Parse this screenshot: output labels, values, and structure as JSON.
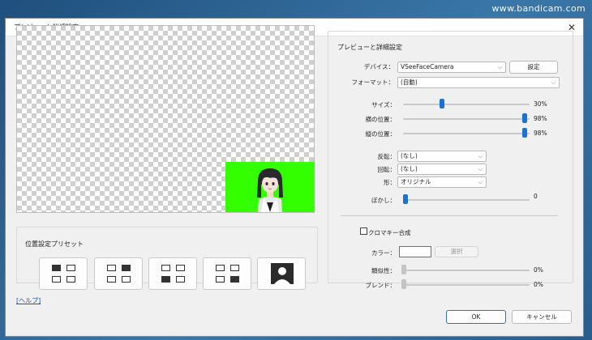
{
  "watermark": "www.bandicam.com",
  "window": {
    "title": "プレビューと詳細設定",
    "close_label": "✕"
  },
  "preset": {
    "group_label": "位置設定プリセット",
    "buttons": [
      {
        "name": "top-left",
        "active_cell": "top-left"
      },
      {
        "name": "top-right",
        "active_cell": "top-right"
      },
      {
        "name": "bottom-left",
        "active_cell": "bottom-left"
      },
      {
        "name": "bottom-right",
        "active_cell": "bottom-right"
      },
      {
        "name": "fullscreen",
        "active_cell": "full"
      }
    ]
  },
  "settings": {
    "group_label": "プレビューと詳細設定",
    "device_label": "デバイス：",
    "device_value": "VSeeFaceCamera",
    "device_settings_button": "設定",
    "format_label": "フォーマット：",
    "format_value": "(自動)",
    "size_label": "サイズ：",
    "size_value": "30%",
    "size_level": 0.3,
    "hpos_label": "横の位置：",
    "hpos_value": "98%",
    "hpos_level": 0.98,
    "vpos_label": "縦の位置：",
    "vpos_value": "98%",
    "vpos_level": 0.98,
    "flip_label": "反転：",
    "flip_value": "(なし)",
    "rotate_label": "回転：",
    "rotate_value": "(なし)",
    "shape_label": "形：",
    "shape_value": "オリジナル",
    "blur_label": "ぼかし：",
    "blur_value": "0",
    "blur_level": 0,
    "chroma_label": "クロマキー合成",
    "color_label": "カラー：",
    "select_button": "選択",
    "similarity_label": "類似性：",
    "similarity_value": "0%",
    "blend_label": "ブレンド：",
    "blend_value": "0%"
  },
  "footer": {
    "help_link": "[ヘルプ]",
    "ok_button": "OK",
    "cancel_button": "キャンセル"
  },
  "colors": {
    "accent": "#1a73d4",
    "chroma_green": "#33ff00"
  }
}
